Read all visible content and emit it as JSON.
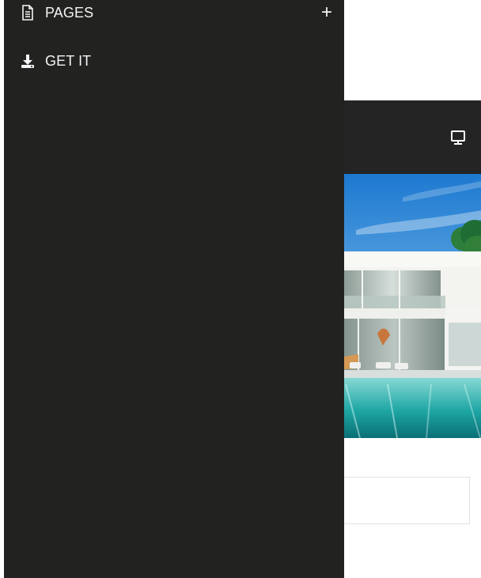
{
  "drawer": {
    "items": [
      {
        "label": "PAGES",
        "icon": "document-icon"
      },
      {
        "label": "GET IT",
        "icon": "download-icon"
      }
    ],
    "expand_label": "+"
  },
  "page_behind": {
    "top_bar": {
      "icon": "desktop-monitor-icon"
    },
    "hero": {
      "image": "modern-villa-with-pool"
    }
  },
  "colors": {
    "drawer_background": "#222321",
    "drawer_text": "#f4f4f4",
    "page_background": "#ffffff",
    "top_bar_background": "#242424"
  }
}
